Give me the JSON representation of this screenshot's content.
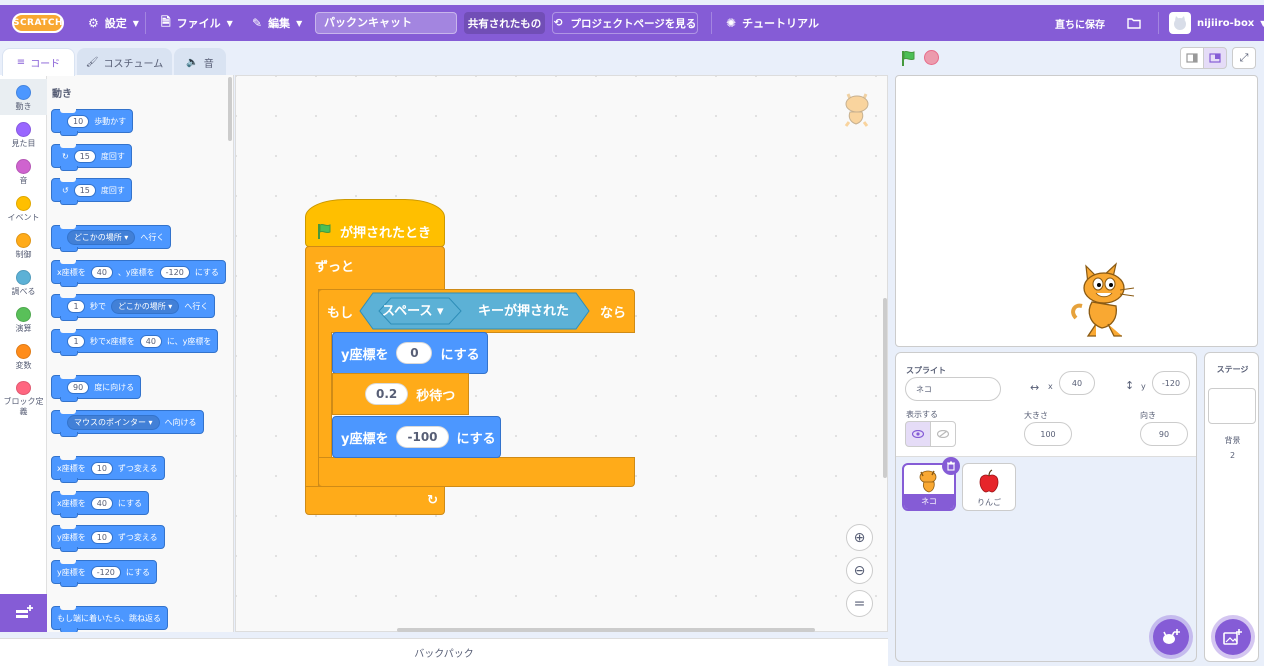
{
  "menu": {
    "logo": "SCRATCH",
    "settings": "設定",
    "file": "ファイル",
    "edit": "編集",
    "project_title": "パックンキャット",
    "shared": "共有されたもの",
    "project_page": "プロジェクトページを見る",
    "tutorial": "チュートリアル",
    "save_now": "直ちに保存",
    "username": "nijiiro-box"
  },
  "tabs": {
    "code": "コード",
    "costume": "コスチューム",
    "sound": "音"
  },
  "categories": [
    {
      "label": "動き",
      "color": "#4c97ff"
    },
    {
      "label": "見た目",
      "color": "#9966ff"
    },
    {
      "label": "音",
      "color": "#cf63cf"
    },
    {
      "label": "イベント",
      "color": "#ffbf00"
    },
    {
      "label": "制御",
      "color": "#ffab19"
    },
    {
      "label": "調べる",
      "color": "#5cb1d6"
    },
    {
      "label": "演算",
      "color": "#59c059"
    },
    {
      "label": "変数",
      "color": "#ff8c1a"
    },
    {
      "label": "ブロック定義",
      "color": "#ff6680"
    }
  ],
  "palette": {
    "heading": "動き",
    "move": {
      "value": "10",
      "text": "歩動かす"
    },
    "turn_right": {
      "value": "15",
      "text": "度回す"
    },
    "turn_left": {
      "value": "15",
      "text": "度回す"
    },
    "goto": {
      "dropdown": "どこかの場所",
      "text": "へ行く"
    },
    "goto_xy": {
      "pre": "x座標を",
      "x": "40",
      "mid": "、y座標を",
      "y": "-120",
      "post": "にする"
    },
    "glide": {
      "value": "1",
      "mid": "秒で",
      "dropdown": "どこかの場所",
      "post": "へ行く"
    },
    "glide_xy": {
      "value": "1",
      "mid": "秒でx座標を",
      "x": "40",
      "mid2": "に、y座標を"
    },
    "point_dir": {
      "value": "90",
      "text": "度に向ける"
    },
    "point_towards": {
      "dropdown": "マウスのポインター",
      "text": "へ向ける"
    },
    "change_x": {
      "pre": "x座標を",
      "value": "10",
      "post": "ずつ変える"
    },
    "set_x": {
      "pre": "x座標を",
      "value": "40",
      "post": "にする"
    },
    "change_y": {
      "pre": "y座標を",
      "value": "10",
      "post": "ずつ変える"
    },
    "set_y": {
      "pre": "y座標を",
      "value": "-120",
      "post": "にする"
    },
    "bounce": "もし端に着いたら、跳ね返る"
  },
  "script": {
    "hat": "が押されたとき",
    "forever": "ずっと",
    "if": "もし",
    "key_dropdown": "スペース",
    "key_pressed": "キーが押された",
    "then": "なら",
    "set_y1": {
      "pre": "y座標を",
      "value": "0",
      "post": "にする"
    },
    "wait": {
      "value": "0.2",
      "post": "秒待つ"
    },
    "set_y2": {
      "pre": "y座標を",
      "value": "-100",
      "post": "にする"
    }
  },
  "backpack": "バックパック",
  "sprite_info": {
    "sprite_label": "スプライト",
    "sprite_name": "ネコ",
    "x_label": "x",
    "x_value": "40",
    "y_label": "y",
    "y_value": "-120",
    "show_label": "表示する",
    "size_label": "大きさ",
    "size_value": "100",
    "direction_label": "向き",
    "direction_value": "90"
  },
  "sprites": [
    {
      "name": "ネコ",
      "selected": true
    },
    {
      "name": "りんご",
      "selected": false
    }
  ],
  "stage_pane": {
    "title": "ステージ",
    "backdrop_label": "背景",
    "backdrop_count": "2"
  },
  "colors": {
    "accent": "#855cd6",
    "motion": "#4c97ff",
    "events": "#ffbf00",
    "control": "#ffab19",
    "sensing": "#5cb1d6"
  }
}
